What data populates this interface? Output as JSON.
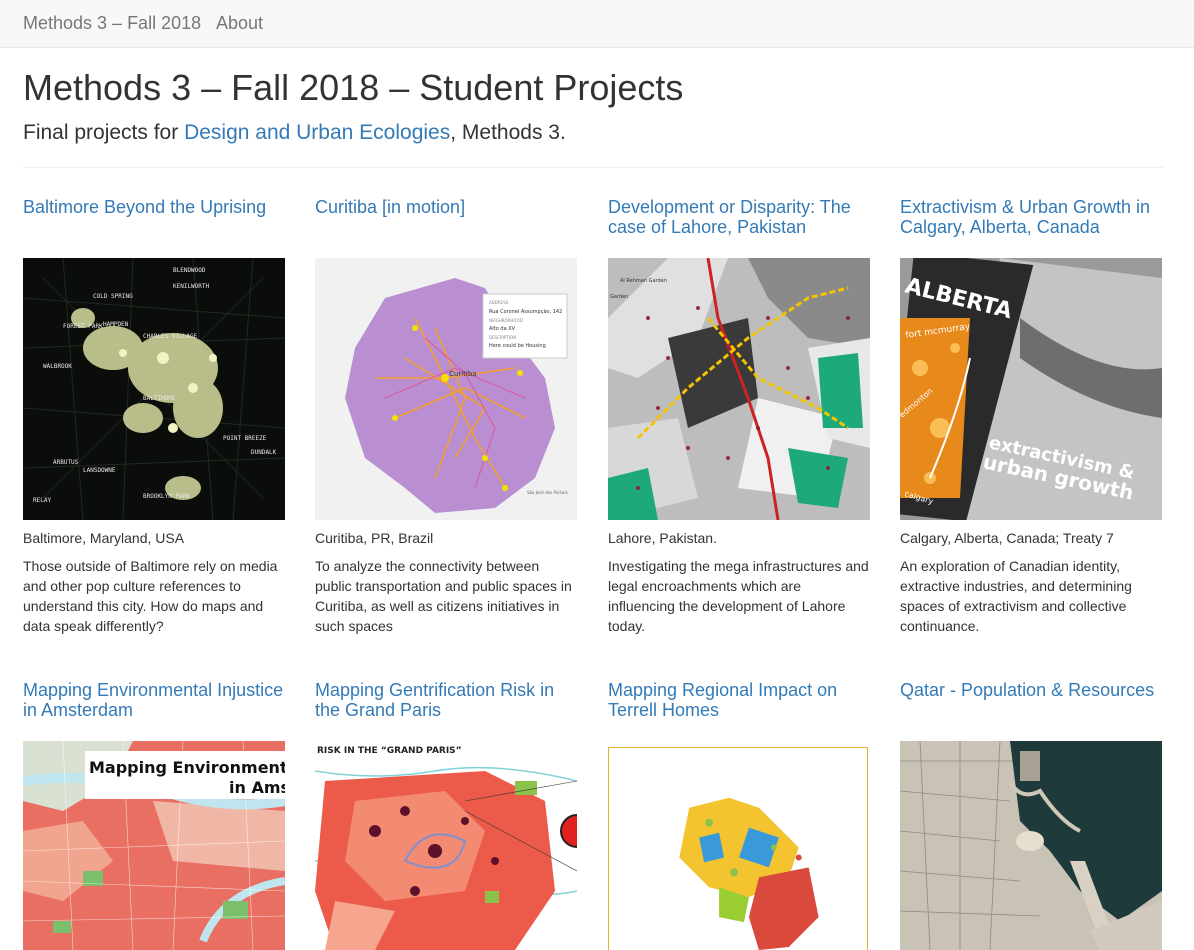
{
  "nav": {
    "brand": "Methods 3 – Fall 2018",
    "about": "About"
  },
  "header": {
    "title": "Methods 3 – Fall 2018 – Student Projects",
    "lead_prefix": "Final projects for ",
    "lead_link": "Design and Urban Ecologies",
    "lead_suffix": ", Methods 3."
  },
  "projects": [
    {
      "title": "Baltimore Beyond the Uprising",
      "location": "Baltimore, Maryland, USA",
      "description": "Those outside of Baltimore rely on media and other pop culture references to understand this city. How do maps and data speak differently?",
      "image_labels": [
        "BLENDWOOD",
        "KENILWORTH",
        "COLD SPRING",
        "FOREST PARK",
        "HAMPDEN",
        "CHARLES VILLAGE",
        "WALBROOK",
        "BALTIMORE",
        "POINT BREEZE",
        "ARBUTUS",
        "LANSDOWNE",
        "RELAY",
        "BROOKLYN PARK",
        "DUNDALK"
      ]
    },
    {
      "title": "Curitiba [in motion]",
      "location": "Curitiba, PR, Brazil",
      "description": "To analyze the connectivity between public transportation and public spaces in Curitiba, as well as citizens initiatives in such spaces",
      "image_labels": [
        "ADDRESS",
        "Rua Coronel Assumpção, 142",
        "NEIGHBORHOOD",
        "Alto da XV",
        "DESCRIPTION",
        "Here could be Housing",
        "Curitiba",
        "São José dos Pinhais"
      ]
    },
    {
      "title": "Development or Disparity: The case of Lahore, Pakistan",
      "location": "Lahore, Pakistan.",
      "description": "Investigating the mega infrastructures and legal encroachments which are influencing the development of Lahore today.",
      "image_labels": [
        "Al Rehman Garden",
        "Garden"
      ]
    },
    {
      "title": "Extractivism & Urban Growth in Calgary, Alberta, Canada",
      "location": "Calgary, Alberta, Canada; Treaty 7",
      "description": "An exploration of Canadian identity, extractive industries, and determining spaces of extractivism and collective continuance.",
      "image_labels": [
        "ALBERTA",
        "fort mcmurray",
        "edmonton",
        "calgary",
        "extractivism &",
        "urban growth"
      ]
    },
    {
      "title": "Mapping Environmental Injustice in Amsterdam",
      "image_labels": [
        "Mapping Environmental Inj",
        "in Amste"
      ]
    },
    {
      "title": "Mapping Gentrification Risk in the Grand Paris",
      "image_labels": [
        "RISK IN THE “GRAND PARIS”"
      ]
    },
    {
      "title": "Mapping Regional Impact on Terrell Homes",
      "image_labels": []
    },
    {
      "title": "Qatar - Population & Resources",
      "image_labels": []
    }
  ]
}
